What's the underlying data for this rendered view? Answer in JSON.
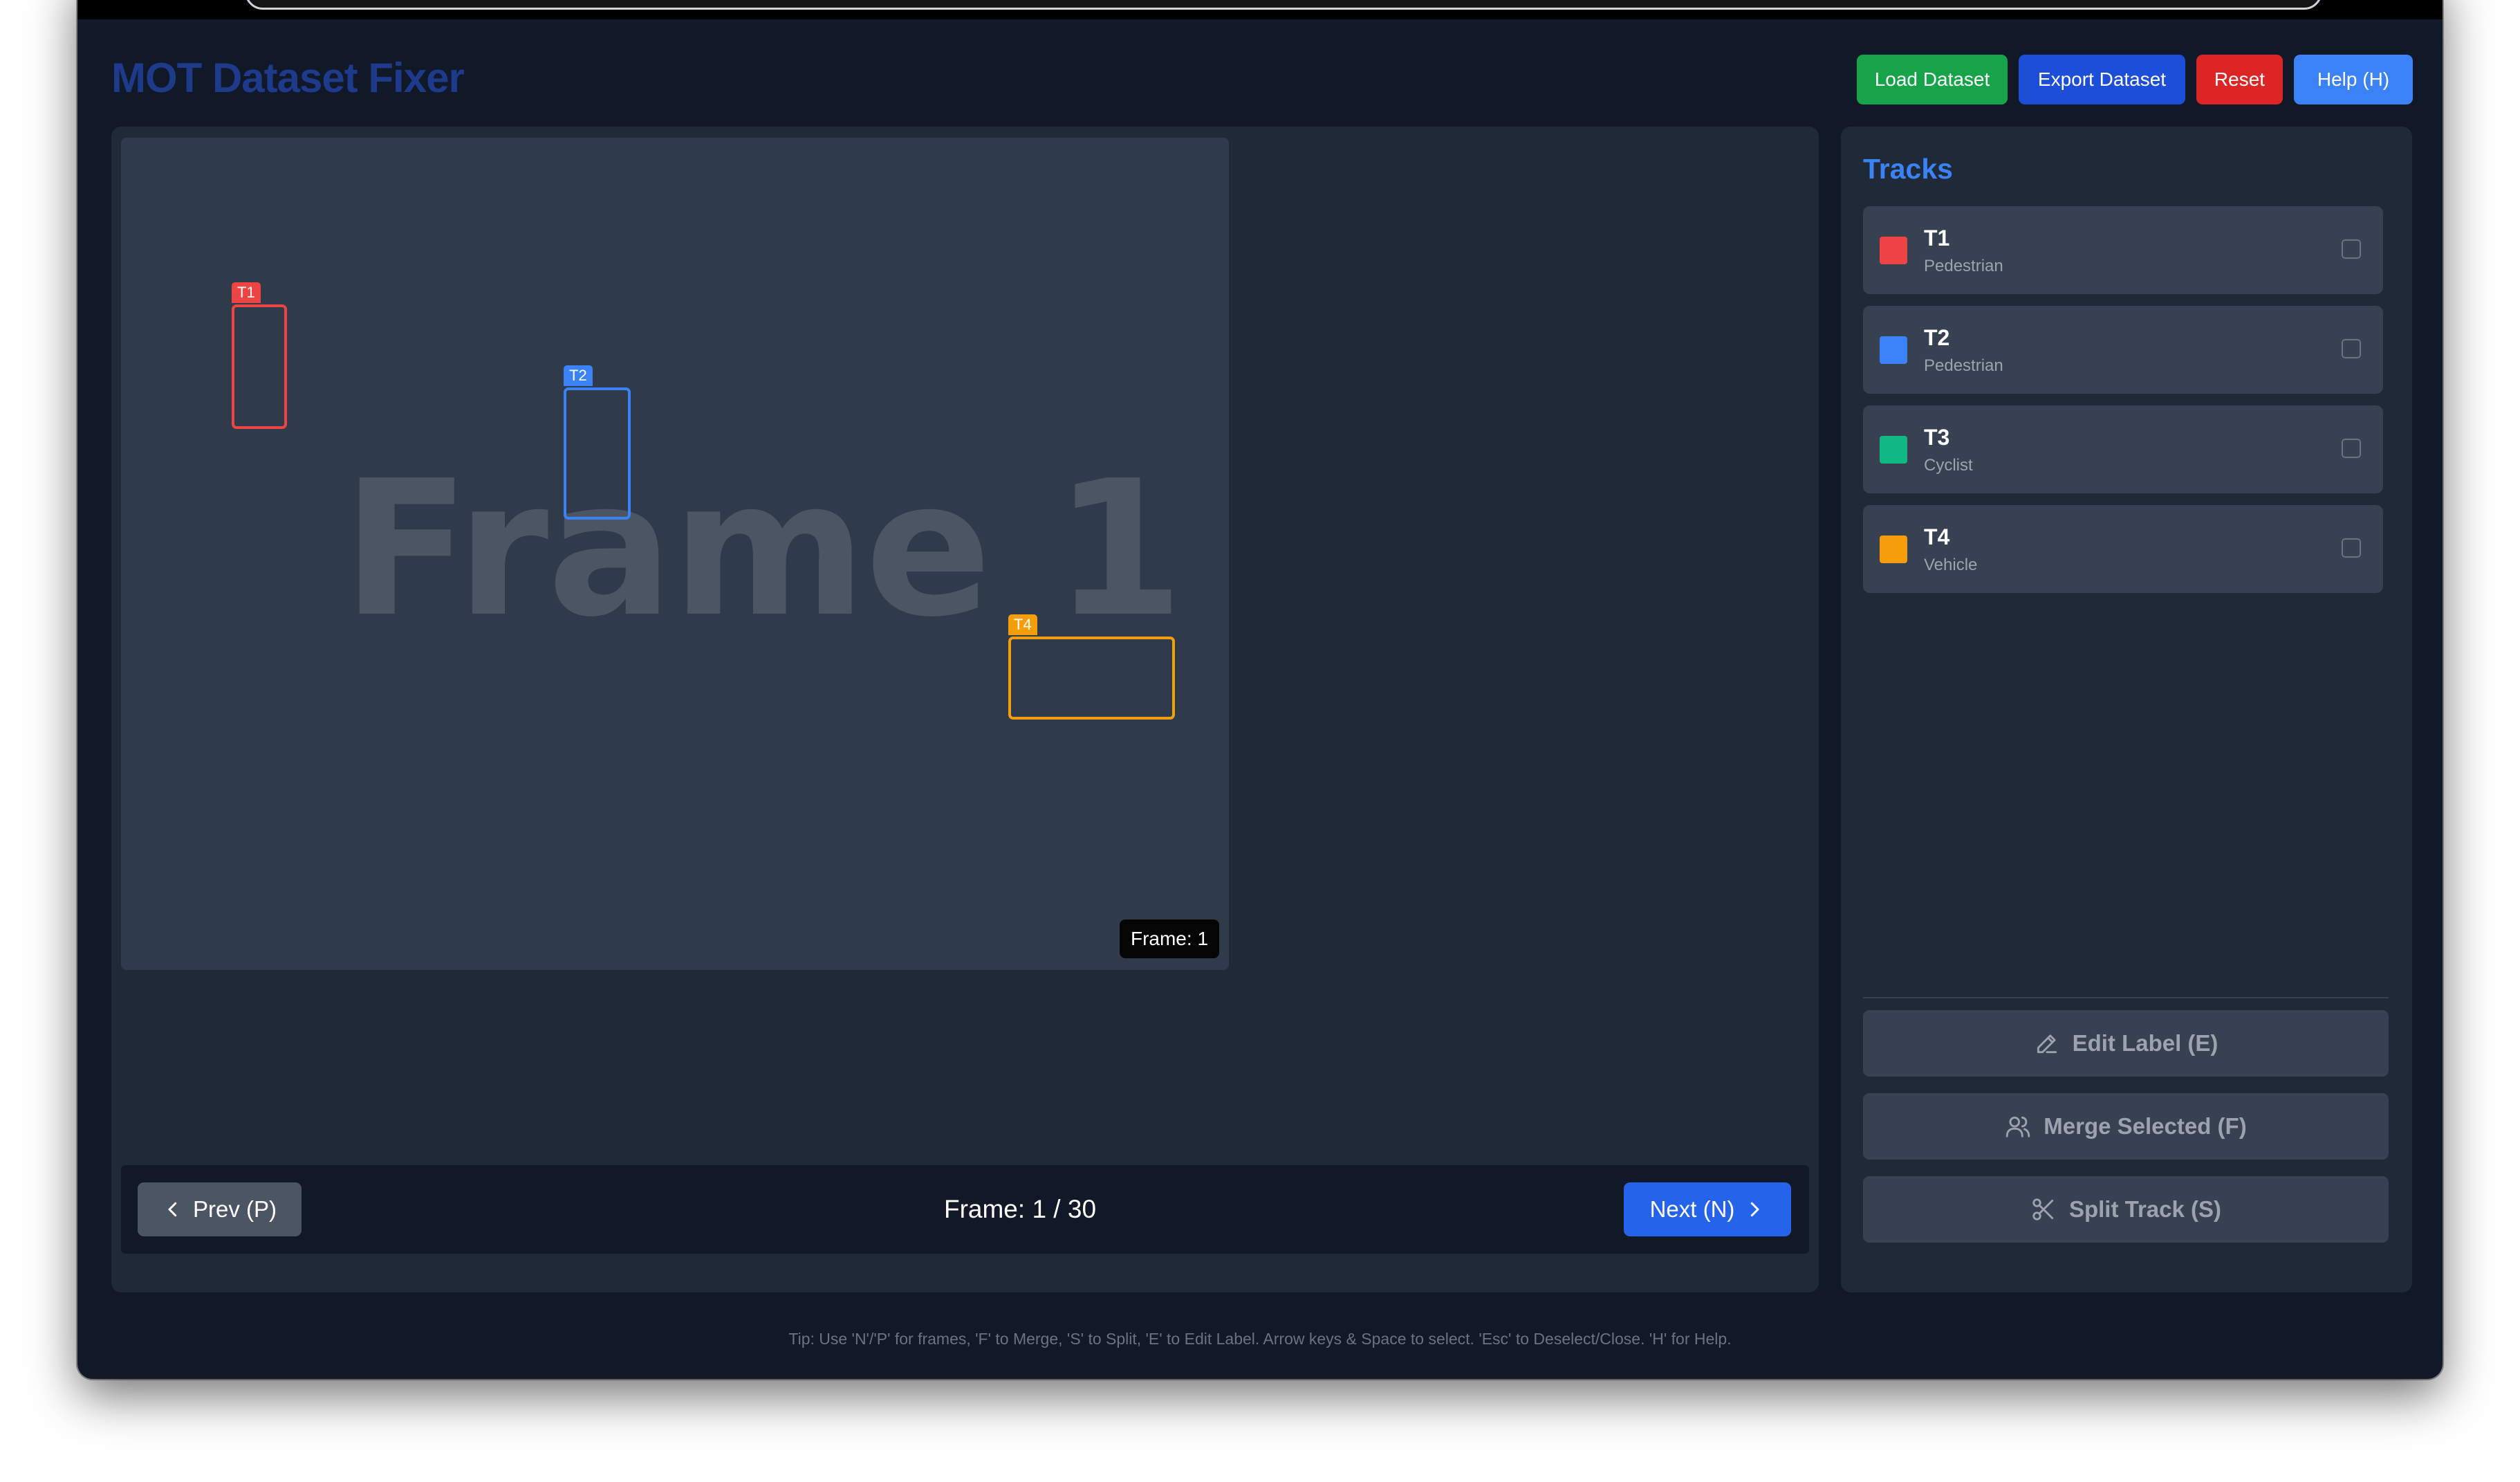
{
  "app": {
    "title": "MOT Dataset Fixer"
  },
  "header": {
    "load_label": "Load Dataset",
    "export_label": "Export Dataset",
    "reset_label": "Reset",
    "help_label": "Help (H)"
  },
  "canvas": {
    "watermark": "Frame 1",
    "frame_chip": "Frame: 1",
    "boxes": [
      {
        "tag": "T1",
        "color": "#ef4444"
      },
      {
        "tag": "T2",
        "color": "#3b82f6"
      },
      {
        "tag": "T4",
        "color": "#f59e0b"
      }
    ]
  },
  "navigation": {
    "prev_label": "Prev (P)",
    "next_label": "Next (N)",
    "frame_counter": "Frame: 1 / 30"
  },
  "tracks": {
    "title": "Tracks",
    "items": [
      {
        "id": "T1",
        "class": "Pedestrian",
        "color": "#ef4444",
        "checked": false
      },
      {
        "id": "T2",
        "class": "Pedestrian",
        "color": "#3b82f6",
        "checked": false
      },
      {
        "id": "T3",
        "class": "Cyclist",
        "color": "#10b981",
        "checked": false
      },
      {
        "id": "T4",
        "class": "Vehicle",
        "color": "#f59e0b",
        "checked": false
      }
    ]
  },
  "actions": {
    "edit_label": "Edit Label (E)",
    "merge_label": "Merge Selected (F)",
    "split_label": "Split Track (S)"
  },
  "footer": {
    "tip": "Tip: Use 'N'/'P' for frames, 'F' to Merge, 'S' to Split, 'E' to Edit Label. Arrow keys & Space to select. 'Esc' to Deselect/Close. 'H' for Help."
  }
}
